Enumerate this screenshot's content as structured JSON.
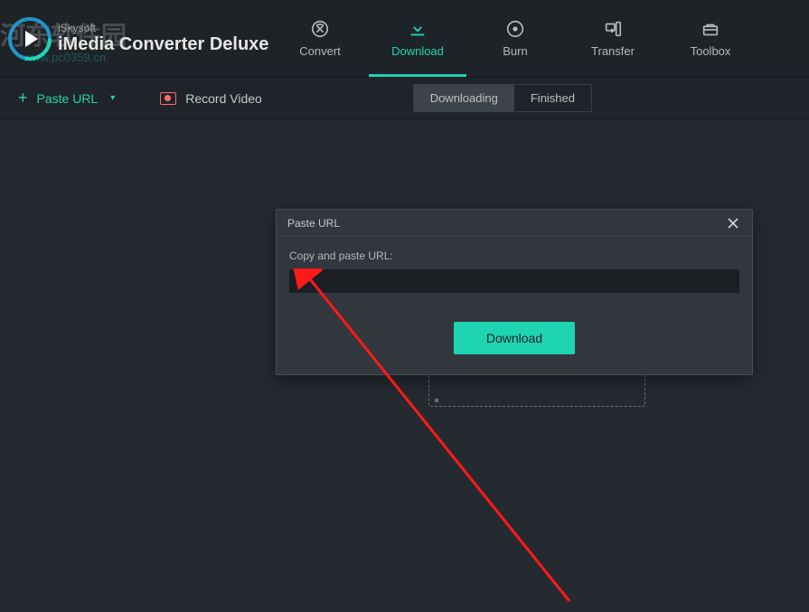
{
  "brand": {
    "sub": "iSkysoft",
    "main": "iMedia Converter Deluxe"
  },
  "watermark": {
    "text": "河东软件园",
    "sub": "www.pc0359.cn"
  },
  "tabs": [
    {
      "label": "Convert"
    },
    {
      "label": "Download"
    },
    {
      "label": "Burn"
    },
    {
      "label": "Transfer"
    },
    {
      "label": "Toolbox"
    }
  ],
  "active_tab_index": 1,
  "toolbar": {
    "paste_url": "Paste URL",
    "record_video": "Record Video"
  },
  "segments": {
    "downloading": "Downloading",
    "finished": "Finished"
  },
  "dialog": {
    "title": "Paste URL",
    "label": "Copy and paste URL:",
    "value": "",
    "download_btn": "Download"
  }
}
